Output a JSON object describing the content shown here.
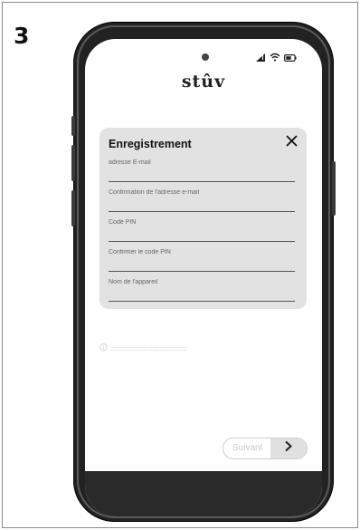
{
  "step": {
    "number": "3"
  },
  "app": {
    "brand": "stûv"
  },
  "card": {
    "title": "Enregistrement",
    "fields": [
      {
        "placeholder": "adresse E-mail",
        "value": ""
      },
      {
        "placeholder": "Confirmation de l'adresse e-mail",
        "value": ""
      },
      {
        "placeholder": "Code PIN",
        "value": ""
      },
      {
        "placeholder": "Confirmer le code PIN",
        "value": ""
      },
      {
        "placeholder": "Nom de l'appareil",
        "value": ""
      }
    ]
  },
  "footer": {
    "next_label": "Suivant"
  },
  "icons": {
    "close": "close-icon",
    "info": "info-icon",
    "next": "chevron-right-icon",
    "signal": "signal-icon",
    "wifi": "wifi-icon",
    "battery": "battery-icon"
  },
  "colors": {
    "card_bg": "#e2e2e2",
    "phone_body": "#222222",
    "bottom_bar": "#2a2a2a",
    "disabled_text": "#c8c8c8"
  }
}
